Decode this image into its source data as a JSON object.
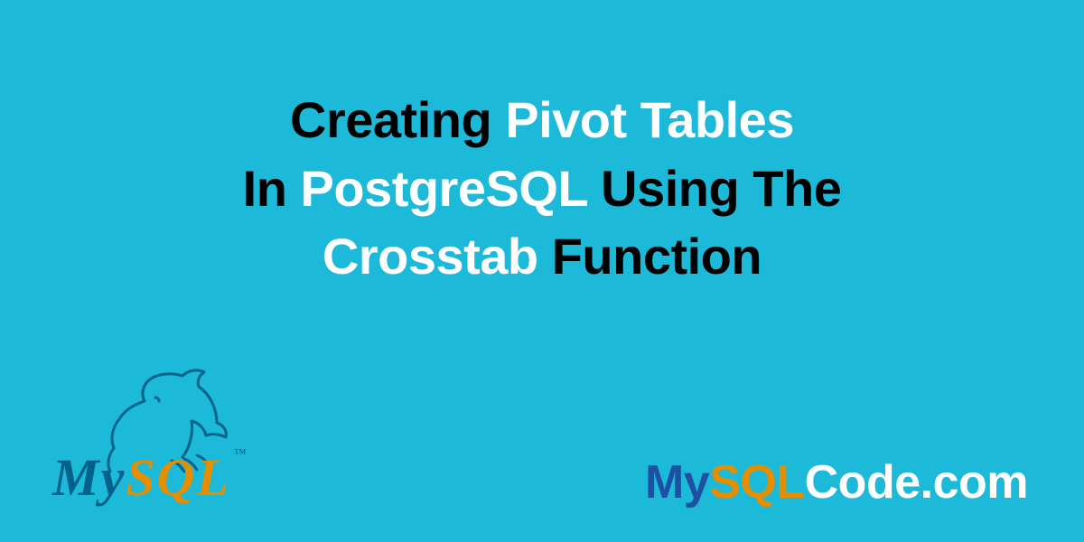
{
  "title": {
    "w1": "Creating",
    "w2": "Pivot Tables",
    "w3": "In",
    "w4": "PostgreSQL",
    "w5": "Using The",
    "w6": "Crosstab",
    "w7": "Function"
  },
  "logo": {
    "word_my": "My",
    "word_sql": "SQL",
    "trademark": "™",
    "icon_name": "dolphin-icon"
  },
  "site": {
    "part1": "My",
    "part2": "SQL",
    "part3": "Code.com"
  },
  "colors": {
    "background": "#1CB9D9",
    "mysql_blue": "#01618A",
    "mysql_orange": "#E48E00",
    "link_blue": "#1e4fa3"
  }
}
